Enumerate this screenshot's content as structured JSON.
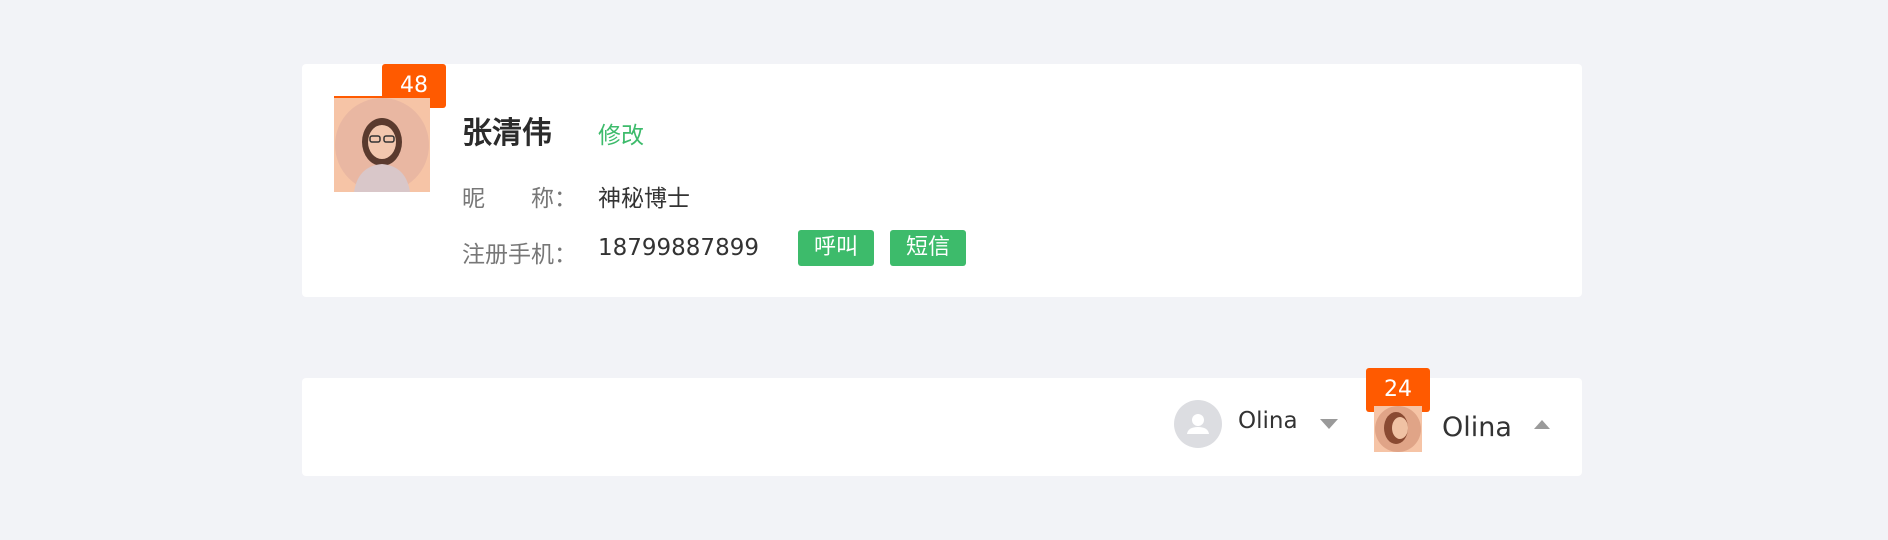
{
  "profile": {
    "badge_count": "48",
    "name": "张清伟",
    "edit_label": "修改",
    "nickname_label": "昵　　称：",
    "nickname_value": "神秘博士",
    "phone_label": "注册手机：",
    "phone_value": "18799887899",
    "call_label": "呼叫",
    "sms_label": "短信"
  },
  "user_bar": {
    "user1_name": "Olina",
    "user2_name": "Olina",
    "user2_badge_count": "24"
  },
  "colors": {
    "accent_orange": "#ff5a00",
    "accent_green": "#3dbb6b",
    "background": "#f2f3f7"
  },
  "icons": {
    "default_avatar": "person-icon",
    "dropdown_closed": "caret-down-icon",
    "dropdown_open": "caret-up-icon"
  }
}
